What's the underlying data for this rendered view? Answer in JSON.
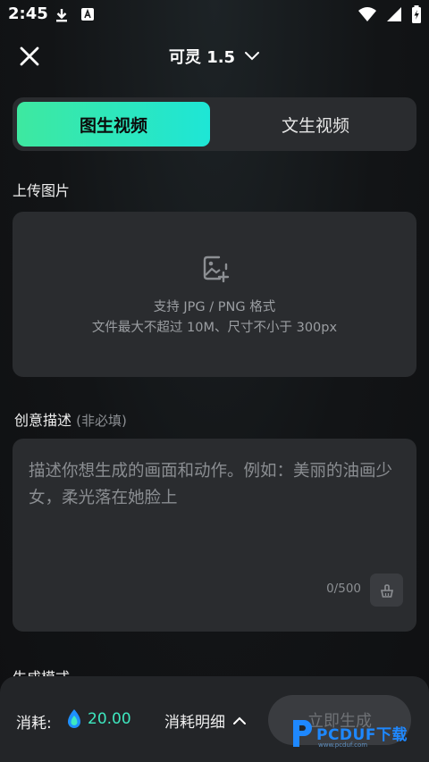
{
  "status_bar": {
    "time": "2:45"
  },
  "top_nav": {
    "model": "可灵 1.5"
  },
  "tabs": [
    {
      "label": "图生视频",
      "active": true
    },
    {
      "label": "文生视频",
      "active": false
    }
  ],
  "upload": {
    "section_label": "上传图片",
    "line1": "支持 JPG / PNG 格式",
    "line2": "文件最大不超过 10M、尺寸不小于 300px"
  },
  "prompt": {
    "section_label": "创意描述",
    "optional_hint": "(非必填)",
    "placeholder": "描述你想生成的画面和动作。例如：美丽的油画少女，柔光落在她脸上",
    "char_count": "0/500"
  },
  "generation_mode": {
    "label": "生成模式"
  },
  "bottom_bar": {
    "cost_label": "消耗:",
    "cost_value": "20.00",
    "cost_detail": "消耗明细",
    "generate_button": "立即生成"
  },
  "watermark": {
    "text": "PCDUF下载",
    "sub": "www.pcduf.com"
  },
  "colors": {
    "accent_start": "#3ee8a0",
    "accent_end": "#1ee6d6",
    "panel": "#2a2c2f"
  }
}
